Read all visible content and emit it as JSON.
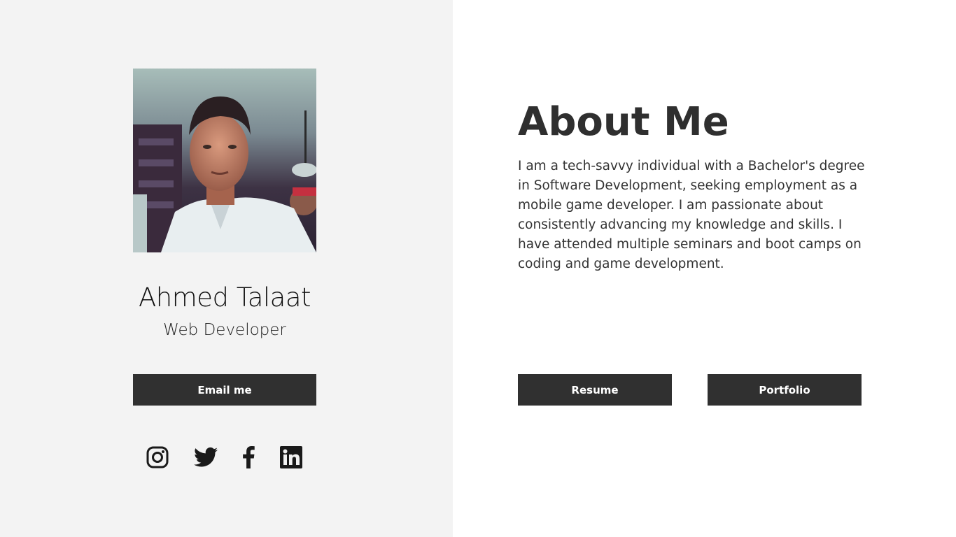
{
  "profile": {
    "name": "Ahmed Talaat",
    "role": "Web Developer",
    "photo_icon": "profile-photo"
  },
  "contact": {
    "email_label": "Email me"
  },
  "socials": [
    {
      "icon": "instagram-icon"
    },
    {
      "icon": "twitter-icon"
    },
    {
      "icon": "facebook-icon"
    },
    {
      "icon": "linkedin-icon"
    }
  ],
  "about": {
    "title": "About Me",
    "text": "I am a tech-savvy individual with a Bachelor's degree in Software Development, seeking employment as a mobile game developer. I am passionate about consistently advancing my knowledge and skills. I have attended multiple seminars and boot camps on coding and game development."
  },
  "actions": {
    "resume_label": "Resume",
    "portfolio_label": "Portfolio"
  },
  "colors": {
    "left_bg": "#f3f3f3",
    "right_bg": "#ffffff",
    "button_bg": "#303030",
    "button_text": "#ffffff",
    "heading": "#2f2f2f"
  }
}
